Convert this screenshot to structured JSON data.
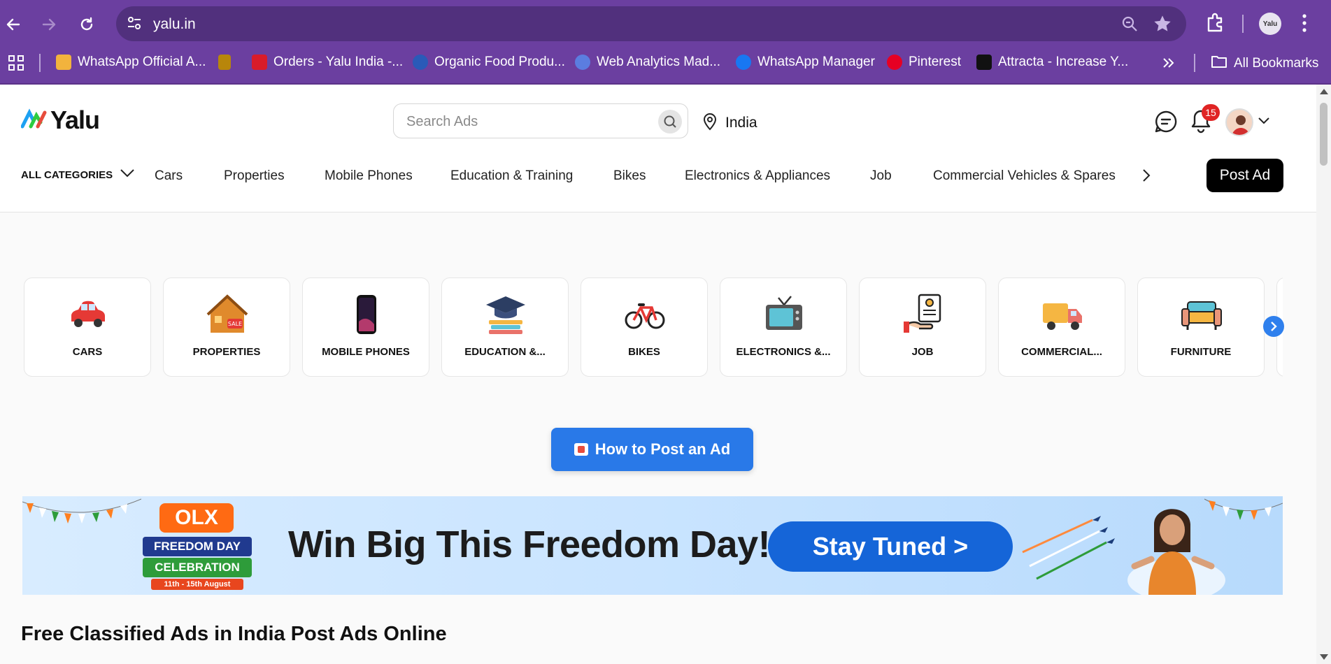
{
  "browser": {
    "url": "yalu.in",
    "profile_initials": "Yalu",
    "bookmarks": [
      {
        "label": "WhatsApp Official A...",
        "icon": "whatsapp-official-favicon",
        "color": "#f2b33d"
      },
      {
        "label": "",
        "icon": "brand-favicon",
        "color": "#b8860b"
      },
      {
        "label": "Orders - Yalu India -...",
        "icon": "yalu-orders-favicon",
        "color": "#d91c2a"
      },
      {
        "label": "Organic Food Produ...",
        "icon": "organic-food-favicon",
        "color": "#2a5ab8"
      },
      {
        "label": "Web Analytics Mad...",
        "icon": "web-analytics-favicon",
        "color": "#5b7de0"
      },
      {
        "label": "WhatsApp Manager",
        "icon": "facebook-favicon",
        "color": "#1877f2"
      },
      {
        "label": "Pinterest",
        "icon": "pinterest-favicon",
        "color": "#e60023"
      },
      {
        "label": "Attracta - Increase Y...",
        "icon": "attracta-favicon",
        "color": "#111111"
      }
    ],
    "all_bookmarks_label": "All Bookmarks"
  },
  "header": {
    "logo_text": "Yalu",
    "search_placeholder": "Search Ads",
    "location": "India",
    "notification_count": "15",
    "all_categories_label": "ALL CATEGORIES",
    "nav_categories": [
      "Cars",
      "Properties",
      "Mobile Phones",
      "Education & Training",
      "Bikes",
      "Electronics & Appliances",
      "Job",
      "Commercial Vehicles & Spares"
    ],
    "post_ad_label": "Post Ad"
  },
  "category_cards": [
    {
      "label": "CARS",
      "icon": "car-icon"
    },
    {
      "label": "PROPERTIES",
      "icon": "house-sale-icon"
    },
    {
      "label": "MOBILE PHONES",
      "icon": "smartphone-icon"
    },
    {
      "label": "EDUCATION &...",
      "icon": "graduation-cap-icon"
    },
    {
      "label": "BIKES",
      "icon": "bicycle-icon"
    },
    {
      "label": "ELECTRONICS &...",
      "icon": "television-icon"
    },
    {
      "label": "JOB",
      "icon": "resume-hand-icon"
    },
    {
      "label": "COMMERCIAL...",
      "icon": "truck-icon"
    },
    {
      "label": "FURNITURE",
      "icon": "sofa-icon"
    }
  ],
  "how_to_post_label": "How to Post an Ad",
  "banner": {
    "brand": "OLX",
    "badge_line1": "FREEDOM DAY",
    "badge_line2": "CELEBRATION",
    "dates": "11th - 15th August",
    "headline": "Win Big This Freedom Day!",
    "cta": "Stay Tuned >"
  },
  "seo_title": "Free Classified Ads in India Post Ads Online",
  "colors": {
    "browser_frame": "#6b3fa0",
    "omnibox": "#51307d",
    "accent_blue": "#2979e8",
    "post_ad_bg": "#000000",
    "badge_red": "#e02424"
  }
}
